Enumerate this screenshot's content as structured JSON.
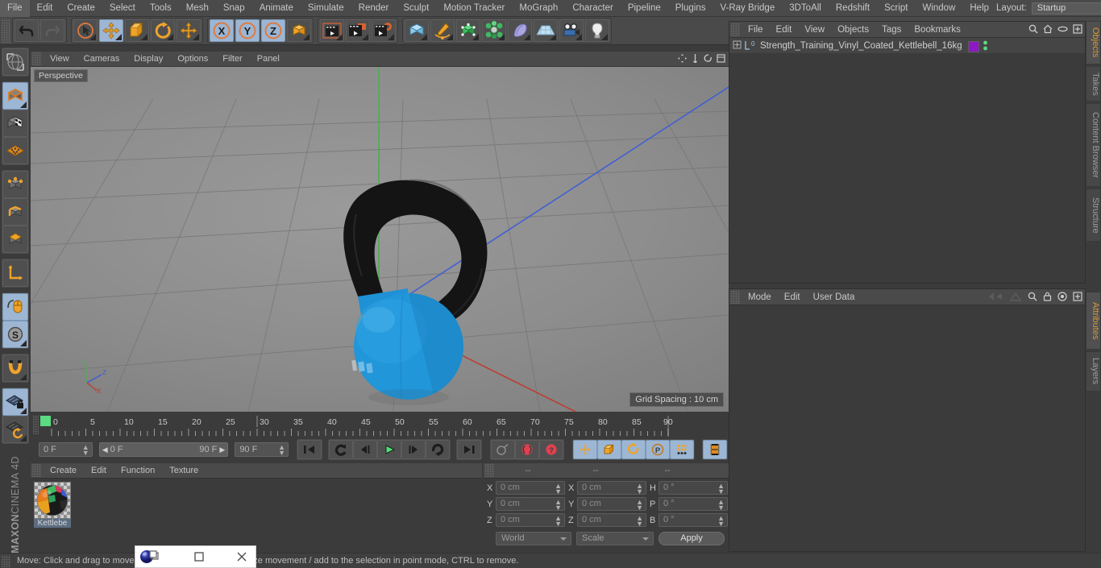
{
  "menubar": {
    "items": [
      "File",
      "Edit",
      "Create",
      "Select",
      "Tools",
      "Mesh",
      "Snap",
      "Animate",
      "Simulate",
      "Render",
      "Sculpt",
      "Motion Tracker",
      "MoGraph",
      "Character",
      "Pipeline",
      "Plugins",
      "V-Ray Bridge",
      "3DToAll",
      "Redshift",
      "Script",
      "Window",
      "Help"
    ],
    "layout_label": "Layout:",
    "layout_value": "Startup",
    "search_icon": "search-icon"
  },
  "toolbar": {
    "groups": [
      {
        "name": "undo-redo",
        "buttons": [
          {
            "icon": "undo-icon",
            "on": false
          },
          {
            "icon": "redo-icon",
            "on": false
          }
        ]
      },
      {
        "name": "transform-tools",
        "buttons": [
          {
            "icon": "select-cursor-icon",
            "on": false
          },
          {
            "icon": "move-icon",
            "on": true
          },
          {
            "icon": "scale-icon",
            "on": false
          },
          {
            "icon": "rotate-icon",
            "on": false
          },
          {
            "icon": "move-axis-icon",
            "on": false
          }
        ]
      },
      {
        "name": "axis-locks",
        "buttons": [
          {
            "icon": "axis-x-icon",
            "on": true
          },
          {
            "icon": "axis-y-icon",
            "on": true
          },
          {
            "icon": "axis-z-icon",
            "on": true
          },
          {
            "icon": "world-axis-icon",
            "on": false
          }
        ]
      },
      {
        "name": "render-tools",
        "buttons": [
          {
            "icon": "render-view-icon",
            "on": false
          },
          {
            "icon": "render-picture-viewer-icon",
            "on": false
          },
          {
            "icon": "render-settings-icon",
            "on": false
          }
        ]
      },
      {
        "name": "create-objects",
        "buttons": [
          {
            "icon": "cube-primitive-icon",
            "on": false
          },
          {
            "icon": "spline-pen-icon",
            "on": false
          },
          {
            "icon": "generator-icon",
            "on": false
          },
          {
            "icon": "mograph-icon",
            "on": false
          },
          {
            "icon": "deformer-icon",
            "on": false
          },
          {
            "icon": "floor-environment-icon",
            "on": false
          },
          {
            "icon": "camera-icon",
            "on": false
          },
          {
            "icon": "light-icon",
            "on": false
          }
        ]
      }
    ]
  },
  "left_toolbar": {
    "buttons": [
      {
        "icon": "render-region-icon",
        "on": false
      },
      {
        "icon": "model-mode-cube-icon",
        "on": true
      },
      {
        "icon": "texture-mode-icon",
        "on": false
      },
      {
        "icon": "workplane-icon",
        "on": false
      },
      {
        "icon": "points-mode-icon",
        "on": false
      },
      {
        "icon": "edges-mode-icon",
        "on": false
      },
      {
        "icon": "polygons-mode-icon",
        "on": false
      },
      {
        "icon": "axis-modify-icon",
        "on": false
      },
      {
        "icon": "enable-snap-mouse-icon",
        "on": true
      },
      {
        "icon": "snap-settings-icon",
        "on": true
      },
      {
        "icon": "magnet-icon",
        "on": false
      },
      {
        "icon": "workplane-lock-icon",
        "on": true
      },
      {
        "icon": "workplane-rotate-icon",
        "on": false
      }
    ],
    "brand_bold": "MAXON",
    "brand_light": "CINEMA 4D"
  },
  "viewport": {
    "menu": [
      "View",
      "Cameras",
      "Display",
      "Options",
      "Filter",
      "Panel"
    ],
    "perspective_label": "Perspective",
    "grid_spacing": "Grid Spacing : 10 cm",
    "axis_labels": {
      "x": "X",
      "y": "Y",
      "z": "Z"
    },
    "colors": {
      "x_axis": "#c0392b",
      "y_axis": "#4caf50",
      "z_axis": "#3b5bdb",
      "kettlebell_body": "#2196d9",
      "kettlebell_handle": "#141414"
    },
    "model_text": "16kg"
  },
  "timeline": {
    "ticks": [
      0,
      5,
      10,
      15,
      20,
      25,
      30,
      35,
      40,
      45,
      50,
      55,
      60,
      65,
      70,
      75,
      80,
      85,
      90
    ],
    "current_frame": "0 F",
    "range_start": "0 F",
    "range_end": "90 F",
    "end_frame": "90 F",
    "frame_field": "0 F",
    "playhead_frame": 0,
    "transport": [
      {
        "icon": "go-to-start-icon",
        "on": false
      },
      {
        "icon": "play-backwards-loop-icon",
        "on": false
      },
      {
        "icon": "step-back-icon",
        "on": false
      },
      {
        "icon": "play-forward-icon",
        "on": true
      },
      {
        "icon": "step-forward-icon",
        "on": false
      },
      {
        "icon": "loop-icon",
        "on": false
      },
      {
        "icon": "go-to-end-icon",
        "on": false
      }
    ],
    "record_tools": [
      {
        "icon": "autokeying-icon",
        "on": false
      },
      {
        "icon": "record-active-objects-icon",
        "on": false
      },
      {
        "icon": "keyframe-selection-icon",
        "on": false
      }
    ],
    "key_tools": [
      {
        "icon": "key-position-icon",
        "on": true
      },
      {
        "icon": "key-scale-icon",
        "on": true
      },
      {
        "icon": "key-rotation-icon",
        "on": true
      },
      {
        "icon": "key-parameter-icon",
        "on": true
      },
      {
        "icon": "key-pla-icon",
        "on": true
      }
    ],
    "timeline_toggle": {
      "icon": "timeline-filmstrip-icon",
      "on": true
    }
  },
  "material_manager": {
    "menu": [
      "Create",
      "Edit",
      "Function",
      "Texture"
    ],
    "materials": [
      {
        "name": "Kettlebe",
        "icon": "material-sphere-icon"
      }
    ]
  },
  "coordinates": {
    "headers": [
      "--",
      "--",
      "--"
    ],
    "position": {
      "label_x": "X",
      "label_y": "Y",
      "label_z": "Z",
      "x": "0 cm",
      "y": "0 cm",
      "z": "0 cm"
    },
    "size": {
      "label_x": "X",
      "label_y": "Y",
      "label_z": "Z",
      "x": "0 cm",
      "y": "0 cm",
      "z": "0 cm"
    },
    "rotation": {
      "label_h": "H",
      "label_p": "P",
      "label_b": "B",
      "h": "0 °",
      "p": "0 °",
      "b": "0 °"
    },
    "coord_system": "World",
    "mode": "Scale",
    "apply_label": "Apply"
  },
  "object_manager": {
    "menu": [
      "File",
      "Edit",
      "View",
      "Objects",
      "Tags",
      "Bookmarks"
    ],
    "icons": [
      "search-icon",
      "home-icon",
      "ellipse-icon",
      "plus-box-icon"
    ],
    "objects": [
      {
        "name": "Strength_Training_Vinyl_Coated_Kettlebell_16kg",
        "layer": "0",
        "material_color": "#8d18c4",
        "visibility_dots": "green"
      }
    ]
  },
  "attributes": {
    "menu": [
      "Mode",
      "Edit",
      "User Data"
    ],
    "icons": [
      "nav-left-icon",
      "nav-up-icon",
      "search-icon",
      "lock-icon",
      "target-icon",
      "plus-box-icon"
    ]
  },
  "vertical_tabs": [
    {
      "label": "Objects",
      "active": true
    },
    {
      "label": "Takes",
      "active": false
    },
    {
      "label": "Content Browser",
      "active": false
    },
    {
      "label": "Structure",
      "active": false
    },
    {
      "label": "Attributes",
      "active": true
    },
    {
      "label": "Layers",
      "active": false
    }
  ],
  "statusbar": {
    "text": "Move: Click and drag to move the selection, SHIFT to quantize movement / add to the selection in point mode, CTRL to remove."
  },
  "overlay_window": {
    "app_icon": "cinema4d-sphere-icon",
    "restore_icon": "restore-window-icon",
    "maximize_icon": "maximize-window-icon",
    "close_icon": "close-window-icon"
  }
}
